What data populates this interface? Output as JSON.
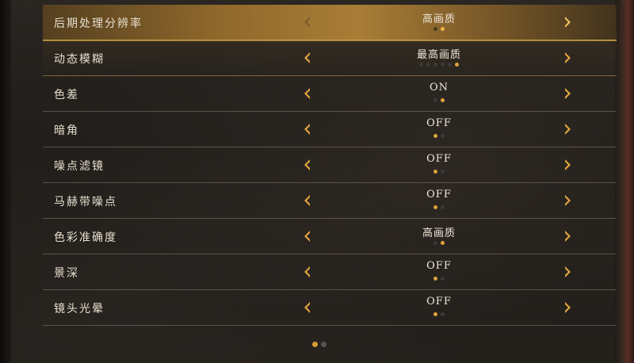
{
  "settings": [
    {
      "label": "后期处理分辨率",
      "value": "高画质",
      "dots": 2,
      "active": 1
    },
    {
      "label": "动态模糊",
      "value": "最高画质",
      "dots": 6,
      "active": 5
    },
    {
      "label": "色差",
      "value": "ON",
      "dots": 2,
      "active": 1
    },
    {
      "label": "暗角",
      "value": "OFF",
      "dots": 2,
      "active": 0
    },
    {
      "label": "噪点滤镜",
      "value": "OFF",
      "dots": 2,
      "active": 0
    },
    {
      "label": "马赫带噪点",
      "value": "OFF",
      "dots": 2,
      "active": 0
    },
    {
      "label": "色彩准确度",
      "value": "高画质",
      "dots": 2,
      "active": 1
    },
    {
      "label": "景深",
      "value": "OFF",
      "dots": 2,
      "active": 0
    },
    {
      "label": "镜头光晕",
      "value": "OFF",
      "dots": 2,
      "active": 0
    }
  ],
  "pagination": {
    "count": 2,
    "active": 0
  },
  "colors": {
    "accent": "#e0a33a",
    "selected_band": "#b08237",
    "text": "#e8e0d0"
  },
  "icons": {
    "prev": "chevron-left-icon",
    "next": "chevron-right-icon"
  }
}
